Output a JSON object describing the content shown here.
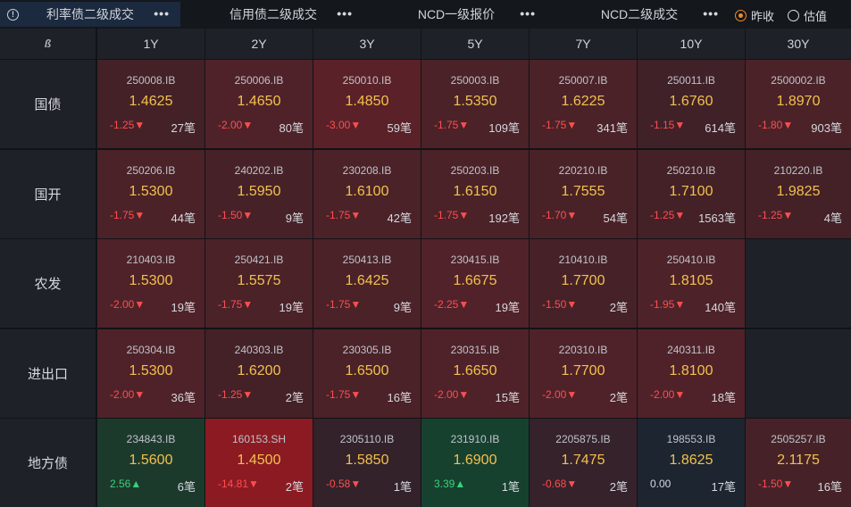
{
  "tabs": [
    {
      "label": "利率债二级成交",
      "active": true
    },
    {
      "label": "信用债二级成交",
      "active": false
    },
    {
      "label": "NCD一级报价",
      "active": false
    },
    {
      "label": "NCD二级成交",
      "active": false
    }
  ],
  "tab_more": "•••",
  "info_icon": "!",
  "price_mode": {
    "options": [
      {
        "label": "昨收",
        "selected": true
      },
      {
        "label": "估值",
        "selected": false
      }
    ],
    "accent_color": "#f08a2b"
  },
  "corner_icon": "ß",
  "columns": [
    "1Y",
    "2Y",
    "3Y",
    "5Y",
    "7Y",
    "10Y",
    "30Y"
  ],
  "colors": {
    "down_text": "#ff4d4f",
    "up_text": "#3ad17b",
    "yield_text": "#f2c14e",
    "down_strong": "#8c1a22",
    "up_strong": "#17412f",
    "neutral": "#1c2530"
  },
  "rows": [
    {
      "label": "国债",
      "cells": [
        {
          "code": "250008.IB",
          "yield": "1.4625",
          "change": "-1.25",
          "dir": "down",
          "count": "27笔",
          "tone": "#432127"
        },
        {
          "code": "250006.IB",
          "yield": "1.4650",
          "change": "-2.00",
          "dir": "down",
          "count": "80笔",
          "tone": "#4f2229"
        },
        {
          "code": "250010.IB",
          "yield": "1.4850",
          "change": "-3.00",
          "dir": "down",
          "count": "59笔",
          "tone": "#5a2128"
        },
        {
          "code": "250003.IB",
          "yield": "1.5350",
          "change": "-1.75",
          "dir": "down",
          "count": "109笔",
          "tone": "#4a2228"
        },
        {
          "code": "250007.IB",
          "yield": "1.6225",
          "change": "-1.75",
          "dir": "down",
          "count": "341笔",
          "tone": "#4a2228"
        },
        {
          "code": "250011.IB",
          "yield": "1.6760",
          "change": "-1.15",
          "dir": "down",
          "count": "614笔",
          "tone": "#402128"
        },
        {
          "code": "2500002.IB",
          "yield": "1.8970",
          "change": "-1.80",
          "dir": "down",
          "count": "903笔",
          "tone": "#4b2228"
        }
      ]
    },
    {
      "label": "国开",
      "cells": [
        {
          "code": "250206.IB",
          "yield": "1.5300",
          "change": "-1.75",
          "dir": "down",
          "count": "44笔",
          "tone": "#4a2228"
        },
        {
          "code": "240202.IB",
          "yield": "1.5950",
          "change": "-1.50",
          "dir": "down",
          "count": "9笔",
          "tone": "#462228"
        },
        {
          "code": "230208.IB",
          "yield": "1.6100",
          "change": "-1.75",
          "dir": "down",
          "count": "42笔",
          "tone": "#4a2228"
        },
        {
          "code": "250203.IB",
          "yield": "1.6150",
          "change": "-1.75",
          "dir": "down",
          "count": "192笔",
          "tone": "#4a2228"
        },
        {
          "code": "220210.IB",
          "yield": "1.7555",
          "change": "-1.70",
          "dir": "down",
          "count": "54笔",
          "tone": "#492228"
        },
        {
          "code": "250210.IB",
          "yield": "1.7100",
          "change": "-1.25",
          "dir": "down",
          "count": "1563笔",
          "tone": "#432127"
        },
        {
          "code": "210220.IB",
          "yield": "1.9825",
          "change": "-1.25",
          "dir": "down",
          "count": "4笔",
          "tone": "#432127"
        }
      ]
    },
    {
      "label": "农发",
      "cells": [
        {
          "code": "210403.IB",
          "yield": "1.5300",
          "change": "-2.00",
          "dir": "down",
          "count": "19笔",
          "tone": "#4f2229"
        },
        {
          "code": "250421.IB",
          "yield": "1.5575",
          "change": "-1.75",
          "dir": "down",
          "count": "19笔",
          "tone": "#4a2228"
        },
        {
          "code": "250413.IB",
          "yield": "1.6425",
          "change": "-1.75",
          "dir": "down",
          "count": "9笔",
          "tone": "#4a2228"
        },
        {
          "code": "230415.IB",
          "yield": "1.6675",
          "change": "-2.25",
          "dir": "down",
          "count": "19笔",
          "tone": "#52222a"
        },
        {
          "code": "210410.IB",
          "yield": "1.7700",
          "change": "-1.50",
          "dir": "down",
          "count": "2笔",
          "tone": "#462228"
        },
        {
          "code": "250410.IB",
          "yield": "1.8105",
          "change": "-1.95",
          "dir": "down",
          "count": "140笔",
          "tone": "#4e2229"
        },
        null
      ]
    },
    {
      "label": "进出口",
      "cells": [
        {
          "code": "250304.IB",
          "yield": "1.5300",
          "change": "-2.00",
          "dir": "down",
          "count": "36笔",
          "tone": "#4f2229"
        },
        {
          "code": "240303.IB",
          "yield": "1.6200",
          "change": "-1.25",
          "dir": "down",
          "count": "2笔",
          "tone": "#432127"
        },
        {
          "code": "230305.IB",
          "yield": "1.6500",
          "change": "-1.75",
          "dir": "down",
          "count": "16笔",
          "tone": "#4a2228"
        },
        {
          "code": "230315.IB",
          "yield": "1.6650",
          "change": "-2.00",
          "dir": "down",
          "count": "15笔",
          "tone": "#4f2229"
        },
        {
          "code": "220310.IB",
          "yield": "1.7700",
          "change": "-2.00",
          "dir": "down",
          "count": "2笔",
          "tone": "#4f2229"
        },
        {
          "code": "240311.IB",
          "yield": "1.8100",
          "change": "-2.00",
          "dir": "down",
          "count": "18笔",
          "tone": "#4f2229"
        },
        null
      ]
    },
    {
      "label": "地方债",
      "cells": [
        {
          "code": "234843.IB",
          "yield": "1.5600",
          "change": "2.56",
          "dir": "up",
          "count": "6笔",
          "tone": "#1c3a2c"
        },
        {
          "code": "160153.SH",
          "yield": "1.4500",
          "change": "-14.81",
          "dir": "down",
          "count": "2笔",
          "tone": "#8c1a22"
        },
        {
          "code": "2305110.IB",
          "yield": "1.5850",
          "change": "-0.58",
          "dir": "down",
          "count": "1笔",
          "tone": "#33222a"
        },
        {
          "code": "231910.IB",
          "yield": "1.6900",
          "change": "3.39",
          "dir": "up",
          "count": "1笔",
          "tone": "#17412f"
        },
        {
          "code": "2205875.IB",
          "yield": "1.7475",
          "change": "-0.68",
          "dir": "down",
          "count": "2笔",
          "tone": "#35222a"
        },
        {
          "code": "198553.IB",
          "yield": "1.8625",
          "change": "0.00",
          "dir": "flat",
          "count": "17笔",
          "tone": "#1c2530"
        },
        {
          "code": "2505257.IB",
          "yield": "2.1175",
          "change": "-1.50",
          "dir": "down",
          "count": "16笔",
          "tone": "#462228"
        }
      ]
    }
  ]
}
